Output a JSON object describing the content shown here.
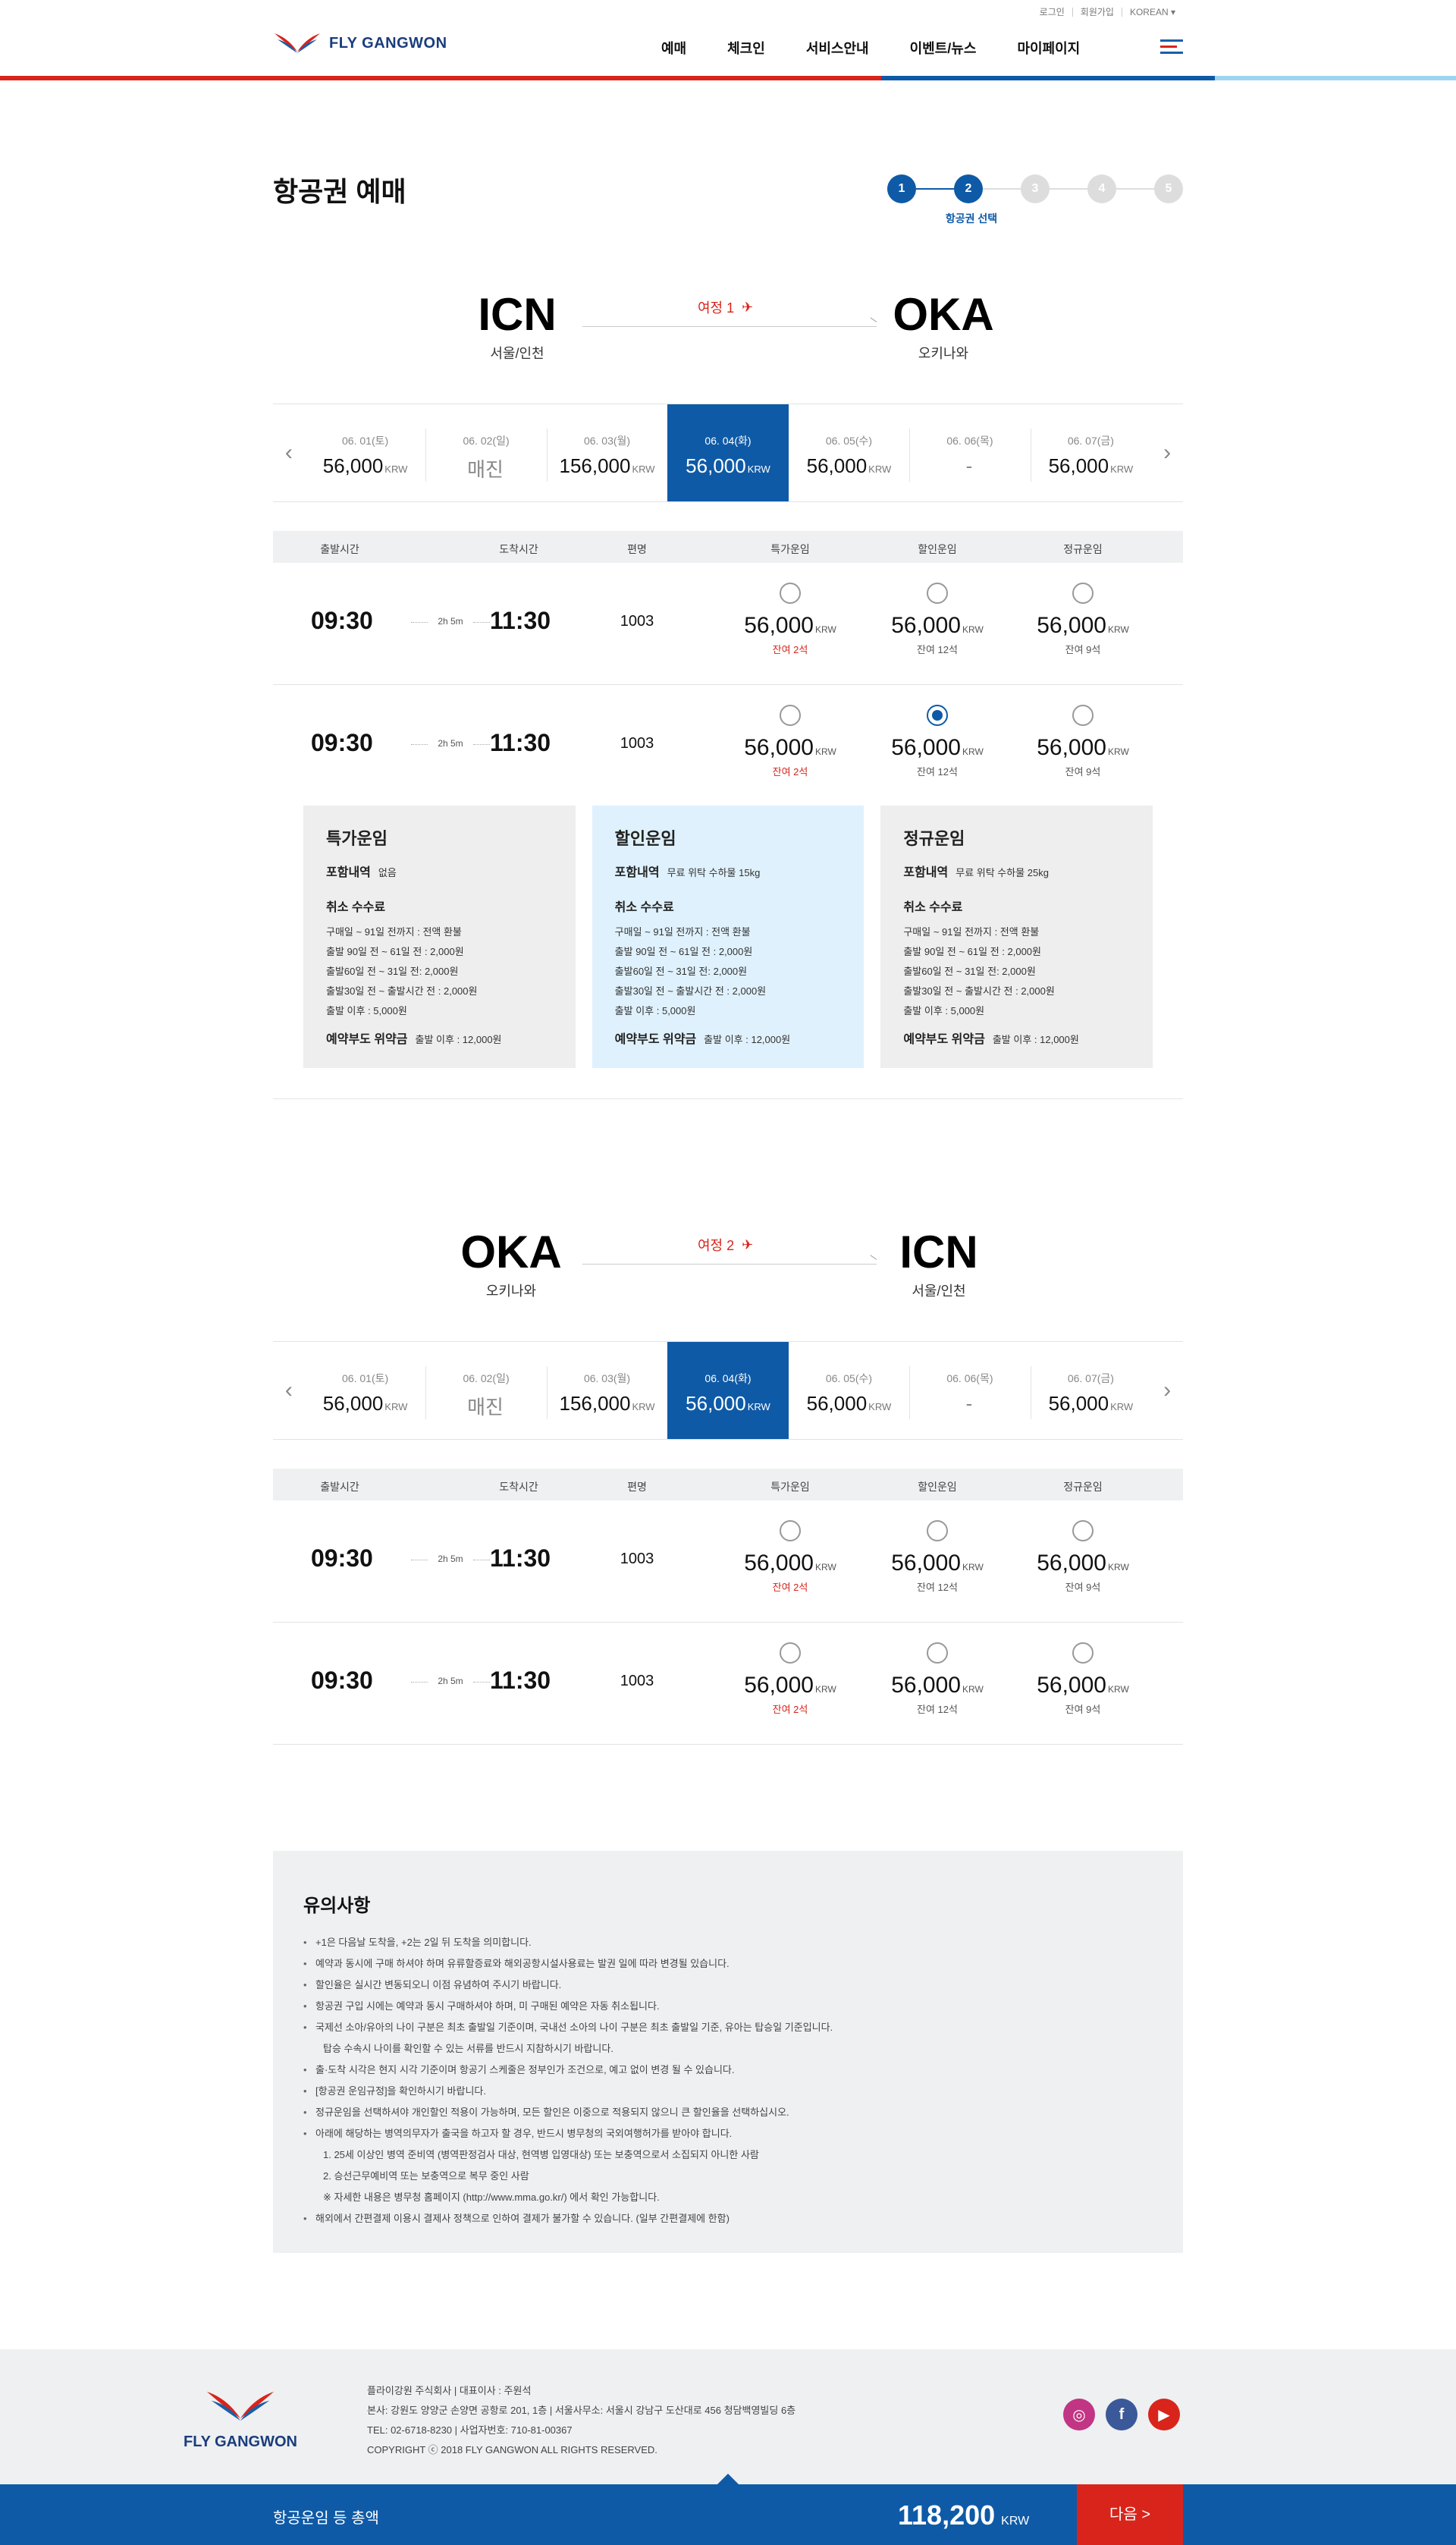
{
  "header": {
    "util": [
      "로그인",
      "회원가입",
      "KOREAN ▾"
    ],
    "logo_text": "FLY GANGWON",
    "nav": [
      "예매",
      "체크인",
      "서비스안내",
      "이벤트/뉴스",
      "마이페이지"
    ]
  },
  "page": {
    "title": "항공권 예매",
    "steps": [
      "1",
      "2",
      "3",
      "4",
      "5"
    ],
    "active_step": 2,
    "step_caption": "항공권 선택"
  },
  "leg1": {
    "label": "여정 1",
    "from_code": "ICN",
    "from_city": "서울/인천",
    "to_code": "OKA",
    "to_city": "오키나와",
    "dates": [
      {
        "d": "06. 01(토)",
        "p": "56,000",
        "u": "KRW"
      },
      {
        "d": "06. 02(일)",
        "p": "매진",
        "u": ""
      },
      {
        "d": "06. 03(월)",
        "p": "156,000",
        "u": "KRW"
      },
      {
        "d": "06. 04(화)",
        "p": "56,000",
        "u": "KRW"
      },
      {
        "d": "06. 05(수)",
        "p": "56,000",
        "u": "KRW"
      },
      {
        "d": "06. 06(목)",
        "p": "-",
        "u": ""
      },
      {
        "d": "06. 07(금)",
        "p": "56,000",
        "u": "KRW"
      }
    ],
    "flights": [
      {
        "dep": "09:30",
        "dur": "2h 5m",
        "arr": "11:30",
        "no": "1003",
        "fares": [
          {
            "amt": "56,000",
            "rem": "잔여 2석"
          },
          {
            "amt": "56,000",
            "rem": "잔여 12석"
          },
          {
            "amt": "56,000",
            "rem": "잔여 9석"
          }
        ]
      },
      {
        "dep": "09:30",
        "dur": "2h 5m",
        "arr": "11:30",
        "no": "1003",
        "fares": [
          {
            "amt": "56,000",
            "rem": "잔여 2석"
          },
          {
            "amt": "56,000",
            "rem": "잔여 12석"
          },
          {
            "amt": "56,000",
            "rem": "잔여 9석"
          }
        ]
      }
    ],
    "selected_flight": 1,
    "selected_fare": 1
  },
  "leg2": {
    "label": "여정 2",
    "from_code": "OKA",
    "from_city": "오키나와",
    "to_code": "ICN",
    "to_city": "서울/인천",
    "dates": [
      {
        "d": "06. 01(토)",
        "p": "56,000",
        "u": "KRW"
      },
      {
        "d": "06. 02(일)",
        "p": "매진",
        "u": ""
      },
      {
        "d": "06. 03(월)",
        "p": "156,000",
        "u": "KRW"
      },
      {
        "d": "06. 04(화)",
        "p": "56,000",
        "u": "KRW"
      },
      {
        "d": "06. 05(수)",
        "p": "56,000",
        "u": "KRW"
      },
      {
        "d": "06. 06(목)",
        "p": "-",
        "u": ""
      },
      {
        "d": "06. 07(금)",
        "p": "56,000",
        "u": "KRW"
      }
    ],
    "flights": [
      {
        "dep": "09:30",
        "dur": "2h 5m",
        "arr": "11:30",
        "no": "1003",
        "fares": [
          {
            "amt": "56,000",
            "rem": "잔여 2석"
          },
          {
            "amt": "56,000",
            "rem": "잔여 12석"
          },
          {
            "amt": "56,000",
            "rem": "잔여 9석"
          }
        ]
      },
      {
        "dep": "09:30",
        "dur": "2h 5m",
        "arr": "11:30",
        "no": "1003",
        "fares": [
          {
            "amt": "56,000",
            "rem": "잔여 2석"
          },
          {
            "amt": "56,000",
            "rem": "잔여 12석"
          },
          {
            "amt": "56,000",
            "rem": "잔여 9석"
          }
        ]
      }
    ]
  },
  "table_head": [
    "출발시간",
    "도착시간",
    "편명",
    "특가운임",
    "할인운임",
    "정규운임"
  ],
  "currency": "KRW",
  "fare_boxes": [
    {
      "title": "특가운임",
      "inc_label": "포함내역",
      "inc": "없음",
      "cancel_title": "취소 수수료",
      "rules": [
        "구매일 ~ 91일 전까지 : 전액 환불",
        "출발 90일 전 ~ 61일 전 : 2,000원",
        "출발60일 전 ~ 31일 전: 2,000원",
        "출발30일 전 ~ 출발시간 전 : 2,000원",
        "출발 이후 : 5,000원"
      ],
      "pen_label": "예약부도 위약금",
      "pen": "출발 이후 : 12,000원"
    },
    {
      "title": "할인운임",
      "inc_label": "포함내역",
      "inc": "무료 위탁 수하물 15kg",
      "cancel_title": "취소 수수료",
      "rules": [
        "구매일 ~ 91일 전까지 : 전액 환불",
        "출발 90일 전 ~ 61일 전 : 2,000원",
        "출발60일 전 ~ 31일 전: 2,000원",
        "출발30일 전 ~ 출발시간 전 : 2,000원",
        "출발 이후 : 5,000원"
      ],
      "pen_label": "예약부도 위약금",
      "pen": "출발 이후 : 12,000원"
    },
    {
      "title": "정규운임",
      "inc_label": "포함내역",
      "inc": "무료 위탁 수하물 25kg",
      "cancel_title": "취소 수수료",
      "rules": [
        "구매일 ~ 91일 전까지 : 전액 환불",
        "출발 90일 전 ~ 61일 전 : 2,000원",
        "출발60일 전 ~ 31일 전: 2,000원",
        "출발30일 전 ~ 출발시간 전 : 2,000원",
        "출발 이후 : 5,000원"
      ],
      "pen_label": "예약부도 위약금",
      "pen": "출발 이후 : 12,000원"
    }
  ],
  "notice": {
    "title": "유의사항",
    "items": [
      {
        "t": "+1은 다음날 도착을, +2는 2일 뒤 도착을 의미합니다.",
        "sub": false
      },
      {
        "t": "예약과 동시에 구매 하셔야 하며 유류할증료와 해외공항시설사용료는 발권 일에 따라 변경될 있습니다.",
        "sub": false
      },
      {
        "t": "할인율은 실시간 변동되오니 이점 유념하여 주시기 바랍니다.",
        "sub": false
      },
      {
        "t": "항공권 구입 시에는 예약과 동시 구매하셔야 하며, 미 구매된 예약은 자동 취소됩니다.",
        "sub": false
      },
      {
        "t": "국제선 소아/유아의 나이 구분은 최초 출발일 기준이며, 국내선 소아의 나이 구분은 최초 출발일 기준, 유아는 탑승일 기준입니다.",
        "sub": false
      },
      {
        "t": "탑승 수속시 나이를 확인할 수 있는 서류를 반드시 지참하시기 바랍니다.",
        "sub": true
      },
      {
        "t": "출·도착 시각은 현지 시각 기준이며 항공기 스케줄은 정부인가 조건으로, 예고 없이 변경 될 수 있습니다.",
        "sub": false
      },
      {
        "t": "[항공권 운임규정]을 확인하시기 바랍니다.",
        "sub": false
      },
      {
        "t": "정규운임을 선택하셔야 개인할인 적용이 가능하며, 모든 할인은 이중으로 적용되지 않으니 큰 할인율을 선택하십시오.",
        "sub": false
      },
      {
        "t": "아래에 해당하는 병역의무자가 출국을 하고자 할 경우, 반드시 병무청의 국외여행허가를 받아야 합니다.",
        "sub": false
      },
      {
        "t": "1. 25세 이상인 병역 준비역 (병역판정검사 대상, 현역병 입영대상) 또는 보충역으로서 소집되지 아니한 사람",
        "sub": true
      },
      {
        "t": "2. 승선근무예비역 또는 보충역으로 복무 중인 사람",
        "sub": true
      },
      {
        "t": "※ 자세한 내용은 병무청 홈페이지 (http://www.mma.go.kr/) 에서 확인 가능합니다.",
        "sub": true
      },
      {
        "t": "해외에서 간편결제 이용시 결제사 정책으로 인하여 결제가 불가할 수 있습니다. (일부 간편결제에 한함)",
        "sub": false
      }
    ]
  },
  "footer": {
    "logo_text": "FLY GANGWON",
    "lines": [
      "플라이강원 주식회사  |  대표이사 : 주원석",
      "본사: 강원도 양양군 손양면 공항로 201, 1층  |  서울사무소: 서울시 강남구 도산대로 456 청담백영빌딩 6층",
      "TEL: 02-6718-8230  |  사업자번호: 710-81-00367",
      "COPYRIGHT ⓒ 2018 FLY GANGWON ALL RIGHTS RESERVED."
    ],
    "sns": [
      {
        "icon": "instagram-icon",
        "color": "#c13584"
      },
      {
        "icon": "facebook-icon",
        "color": "#3b5998"
      },
      {
        "icon": "youtube-icon",
        "color": "#d9241b"
      }
    ]
  },
  "bottom": {
    "label": "항공운임 등 총액",
    "total": "118,200",
    "currency": "KRW",
    "next": "다음 >"
  },
  "colors": {
    "primary": "#0f5aa6",
    "accent": "#d9241b",
    "blue_box": "#dff1fc"
  }
}
